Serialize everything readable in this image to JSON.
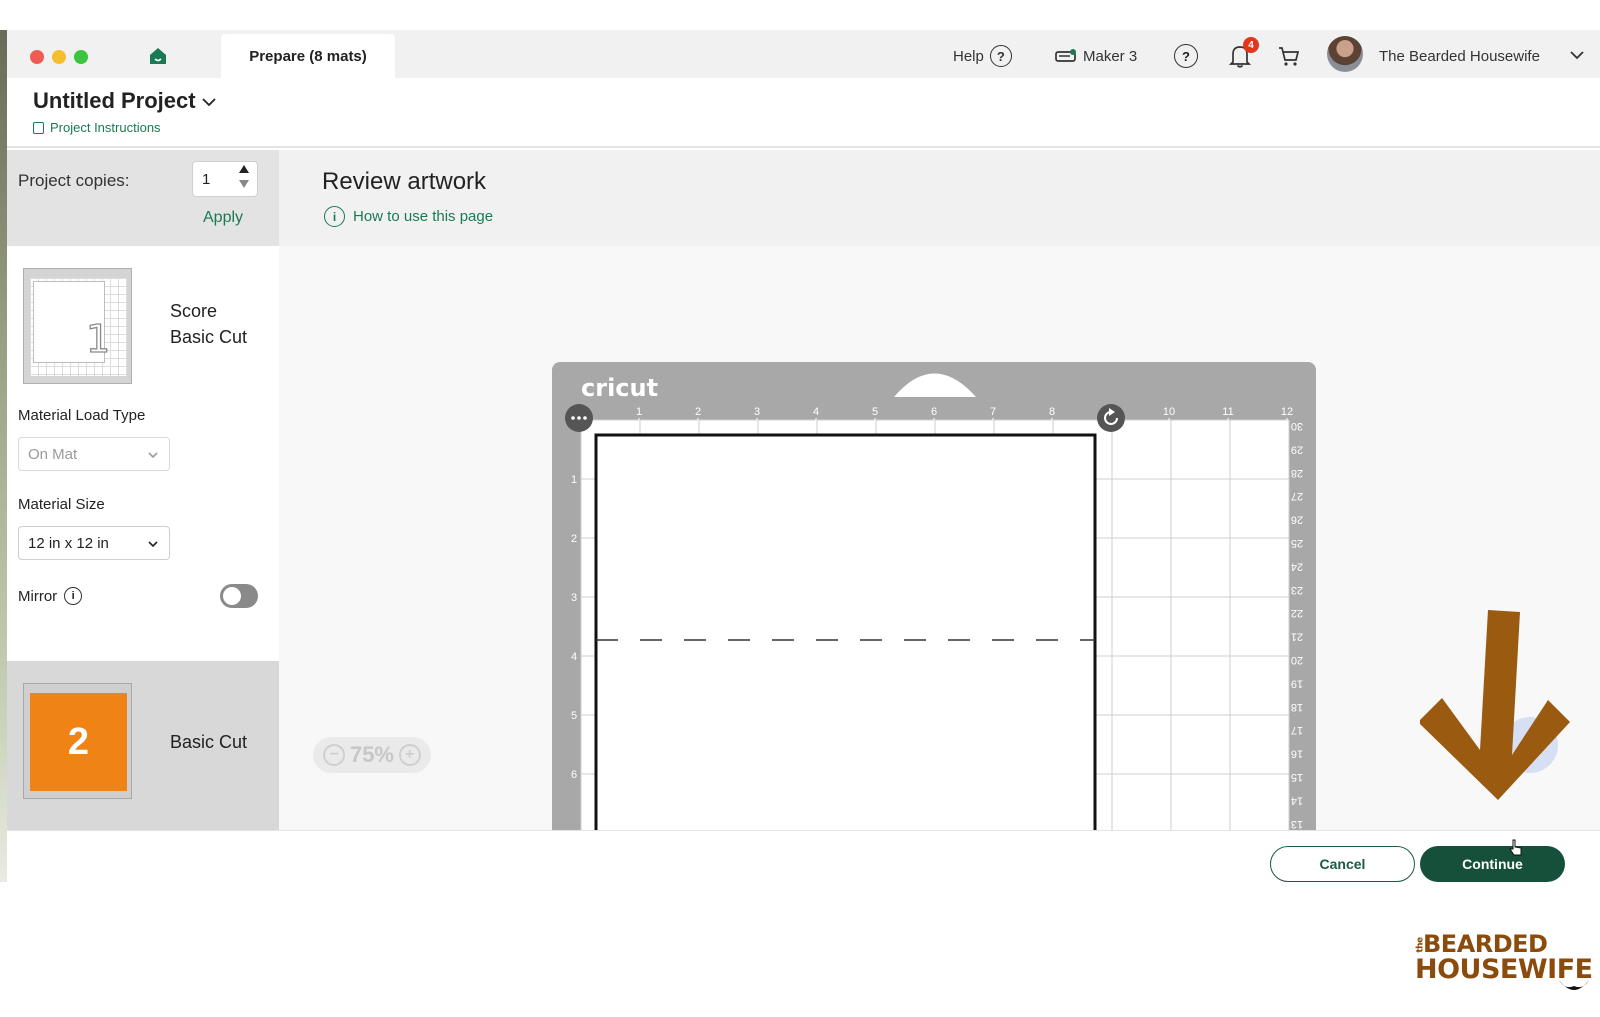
{
  "titlebar": {
    "tab_label": "Prepare (8 mats)",
    "help_label": "Help",
    "machine_label": "Maker 3",
    "notification_count": "4",
    "user_name": "The Bearded Housewife"
  },
  "project": {
    "title": "Untitled Project",
    "instructions_link": "Project Instructions"
  },
  "left_panel": {
    "copies_label": "Project copies:",
    "copies_value": "1",
    "apply_label": "Apply",
    "mats": [
      {
        "number": "1",
        "operations": [
          "Score",
          "Basic Cut"
        ],
        "color": "#ffffff"
      },
      {
        "number": "2",
        "operations": [
          "Basic Cut"
        ],
        "color": "#f08316"
      }
    ],
    "material_load_type_label": "Material Load Type",
    "material_load_type_value": "On Mat",
    "material_size_label": "Material Size",
    "material_size_value": "12 in x 12 in",
    "mirror_label": "Mirror",
    "mirror_on": false
  },
  "main": {
    "title": "Review artwork",
    "howto_link": "How to use this page",
    "zoom_label": "75%",
    "mat": {
      "brand": "cricut",
      "top_ruler": [
        "1",
        "2",
        "3",
        "4",
        "5",
        "6",
        "7",
        "8",
        "10",
        "11",
        "12"
      ],
      "left_ruler": [
        "1",
        "2",
        "3",
        "4",
        "5",
        "6"
      ],
      "right_ruler": [
        "30",
        "29",
        "28",
        "27",
        "26",
        "25",
        "24",
        "23",
        "22",
        "21",
        "20",
        "19",
        "18",
        "17",
        "16",
        "15",
        "14",
        "13"
      ]
    }
  },
  "footer": {
    "cancel_label": "Cancel",
    "continue_label": "Continue"
  },
  "watermark": {
    "line1": "BEARDED",
    "line2": "HOUSEWIFE",
    "prefix": "the"
  },
  "colors": {
    "accent_green": "#1a7a53",
    "button_dark_green": "#16503a",
    "arrow_brown": "#9a5a10",
    "notification_red": "#e2361c"
  }
}
